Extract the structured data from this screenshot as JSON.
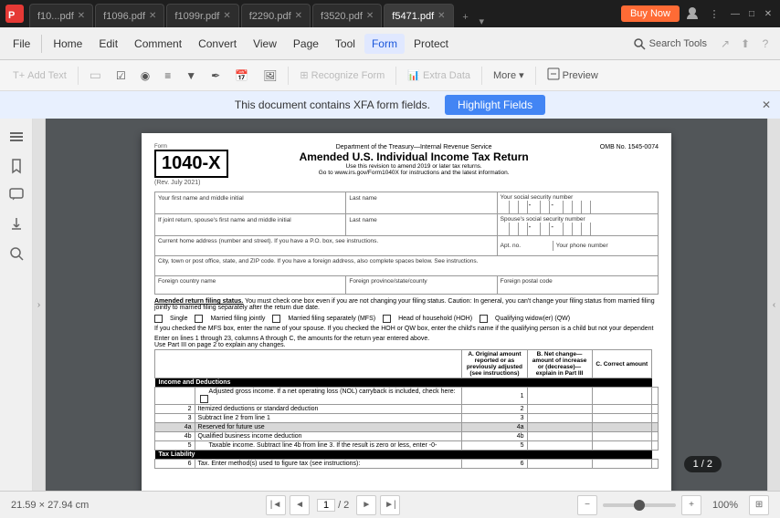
{
  "titleBar": {
    "tabs": [
      {
        "id": "f110",
        "label": "f10...pdf",
        "active": false
      },
      {
        "id": "f1096",
        "label": "f1096.pdf",
        "active": false
      },
      {
        "id": "f1099",
        "label": "f1099r.pdf",
        "active": false
      },
      {
        "id": "f2290",
        "label": "f2290.pdf",
        "active": false
      },
      {
        "id": "f3520",
        "label": "f3520.pdf",
        "active": false
      },
      {
        "id": "f5471",
        "label": "f5471.pdf",
        "active": true
      }
    ],
    "buyNow": "Buy Now",
    "windowControls": [
      "—",
      "□",
      "✕"
    ]
  },
  "menuBar": {
    "items": [
      {
        "id": "file",
        "label": "File",
        "active": false
      },
      {
        "id": "home",
        "label": "Home",
        "active": false
      },
      {
        "id": "edit",
        "label": "Edit",
        "active": false
      },
      {
        "id": "comment",
        "label": "Comment",
        "active": false
      },
      {
        "id": "convert",
        "label": "Convert",
        "active": false
      },
      {
        "id": "view",
        "label": "View",
        "active": false
      },
      {
        "id": "page",
        "label": "Page",
        "active": false
      },
      {
        "id": "tool",
        "label": "Tool",
        "active": false
      },
      {
        "id": "form",
        "label": "Form",
        "active": true
      },
      {
        "id": "protect",
        "label": "Protect",
        "active": false
      }
    ],
    "searchPlaceholder": "Search Tools"
  },
  "toolbar": {
    "items": [
      {
        "id": "add-text",
        "label": "Add Text",
        "disabled": true
      },
      {
        "id": "field",
        "label": "",
        "icon": "field-icon",
        "disabled": true
      },
      {
        "id": "checkbox",
        "label": "",
        "icon": "checkbox-icon",
        "disabled": false
      },
      {
        "id": "radio",
        "label": "",
        "icon": "radio-icon",
        "disabled": false
      },
      {
        "id": "more1",
        "label": "",
        "disabled": true
      },
      {
        "id": "more2",
        "label": "",
        "disabled": true
      },
      {
        "id": "more3",
        "label": "",
        "disabled": true
      },
      {
        "id": "recognize",
        "label": "Recognize Form",
        "disabled": true
      },
      {
        "id": "extra-data",
        "label": "Extra Data",
        "disabled": true
      },
      {
        "id": "more",
        "label": "More ▾",
        "disabled": false
      },
      {
        "id": "preview",
        "label": "Preview",
        "icon": "preview-icon",
        "disabled": false
      }
    ]
  },
  "notification": {
    "message": "This document contains XFA form fields.",
    "buttonLabel": "Highlight Fields",
    "closeLabel": "✕"
  },
  "sidebar": {
    "icons": [
      "layers",
      "bookmark",
      "comment",
      "attachment",
      "search"
    ]
  },
  "document": {
    "header": {
      "formNumber": "Form",
      "formTitle": "1040-X",
      "revDate": "(Rev. July 2021)",
      "deptLine": "Department of the Treasury—Internal Revenue Service",
      "mainTitle": "Amended U.S. Individual Income Tax Return",
      "subTitle": "Use this revision to amend 2019 or later tax returns.",
      "linkLine": "Go to www.irs.gov/Form1040X for instructions and the latest information.",
      "omb": "OMB No. 1545-0074"
    },
    "fields": {
      "yourName": "Your first name and middle initial",
      "lastName": "Last name",
      "ssn": "Your social security number",
      "spouseName": "If joint return, spouse's first name and middle initial",
      "spouseLastName": "Last name",
      "spouseSSN": "Spouse's social security number",
      "address": "Current home address (number and street). If you have a P.O. box, see instructions.",
      "aptNo": "Apt. no.",
      "phone": "Your phone number",
      "city": "City, town or post office, state, and ZIP code. If you have a foreign address, also complete spaces below. See instructions.",
      "foreignCountry": "Foreign country name",
      "foreignProvince": "Foreign province/state/county",
      "foreignPostal": "Foreign postal code"
    },
    "filingStatus": {
      "title": "Amended return filing status.",
      "note": "You must check one box even if you are not changing your filing status. Caution: In general, you can't change your filing status from married filing jointly to married filing separately after the return due date.",
      "options": [
        {
          "id": "single",
          "label": "Single"
        },
        {
          "id": "mfj",
          "label": "Married filing jointly"
        },
        {
          "id": "mfs",
          "label": "Married filing separately (MFS)"
        },
        {
          "id": "hoh",
          "label": "Head of household (HOH)"
        },
        {
          "id": "qw",
          "label": "Qualifying widow(er) (QW)"
        }
      ],
      "mfsNote": "If you checked the MFS box, enter the name of your spouse. If you checked the HOH or QW box, enter the child's name if the qualifying person is a child but not your dependent"
    },
    "incomeNote": "Enter on lines 1 through 23, columns A through C, the amounts for the return year entered above.",
    "partIIINote": "Use Part III on page 2 to explain any changes.",
    "columns": {
      "a": "A. Original amount reported or as previously adjusted (see instructions)",
      "b": "B. Net change—amount of increase or (decrease)— explain in Part III",
      "c": "C. Correct  amount"
    },
    "sections": [
      {
        "id": "income",
        "title": "Income and Deductions",
        "rows": [
          {
            "num": "",
            "indent": true,
            "label": "Adjusted gross income. If a net operating loss (NOL) carryback is included, check here:",
            "lineNum": "1",
            "gray": false
          },
          {
            "num": "2",
            "indent": false,
            "label": "Itemized deductions or standard deduction",
            "lineNum": "2",
            "gray": false
          },
          {
            "num": "3",
            "indent": false,
            "label": "Subtract line 2 from line 1",
            "lineNum": "3",
            "gray": false
          },
          {
            "num": "4a",
            "indent": false,
            "label": "Reserved for future use",
            "lineNum": "4a",
            "gray": true
          },
          {
            "num": "4b",
            "indent": false,
            "label": "Qualified business income deduction",
            "lineNum": "4b",
            "gray": false
          },
          {
            "num": "5",
            "indent": false,
            "label": "",
            "lineNum": "5",
            "gray": false
          },
          {
            "num": "",
            "indent": true,
            "label": "Taxable income. Subtract line 4b from line 3. If the result is zero or less, enter -0-",
            "lineNum": "5",
            "gray": false
          }
        ]
      },
      {
        "id": "tax-liability",
        "title": "Tax Liability",
        "rows": [
          {
            "num": "6",
            "indent": false,
            "label": "Tax. Enter method(s) used to figure tax (see instructions):",
            "lineNum": "6",
            "gray": false
          }
        ]
      }
    ]
  },
  "statusBar": {
    "dimensions": "21.59 × 27.94 cm",
    "page": "1 / 2",
    "zoom": "100%",
    "zoomPercent": 50
  }
}
